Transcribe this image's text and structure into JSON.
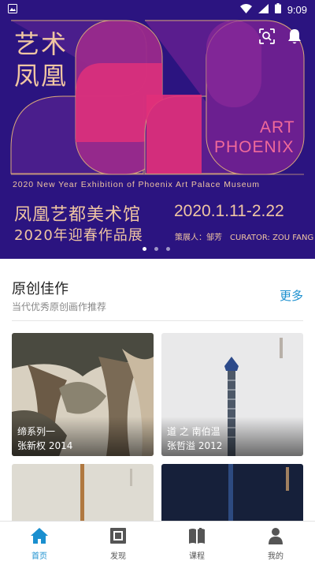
{
  "status_bar": {
    "time": "9:09"
  },
  "hero": {
    "title_cn": "艺术凤凰",
    "art_word_1": "ART",
    "art_word_2": "PHOENIX",
    "subtitle_en": "2020 New Year Exhibition of Phoenix Art Palace Museum",
    "venue": "凤凰艺都美术馆",
    "dates": "2020.1.11-2.22",
    "show": "2020年迎春作品展",
    "curator_cn": "策展人：邹芳",
    "curator_en": "CURATOR: ZOU FANG",
    "slide_count": 3,
    "active_slide": 1,
    "colors": {
      "background": "#2b1480",
      "accent_pink": "#e0307a",
      "gold": "#f0c6a2"
    },
    "icons": {
      "scan": "scan-icon",
      "notification": "bell-icon"
    }
  },
  "section": {
    "title": "原创佳作",
    "subtitle": "当代优秀原创画作推荐",
    "more_label": "更多",
    "cards": [
      {
        "title": "缔系列一",
        "author_year": "张新权 2014"
      },
      {
        "title": "道 之 南伯温",
        "author_year": "张哲溢 2012"
      },
      {
        "title": "",
        "author_year": ""
      },
      {
        "title": "",
        "author_year": ""
      }
    ]
  },
  "nav": {
    "items": [
      {
        "label": "首页",
        "icon": "home-icon",
        "active": true
      },
      {
        "label": "发现",
        "icon": "discover-icon",
        "active": false
      },
      {
        "label": "课程",
        "icon": "book-icon",
        "active": false
      },
      {
        "label": "我的",
        "icon": "person-icon",
        "active": false
      }
    ],
    "active_color": "#1a8fcf"
  }
}
